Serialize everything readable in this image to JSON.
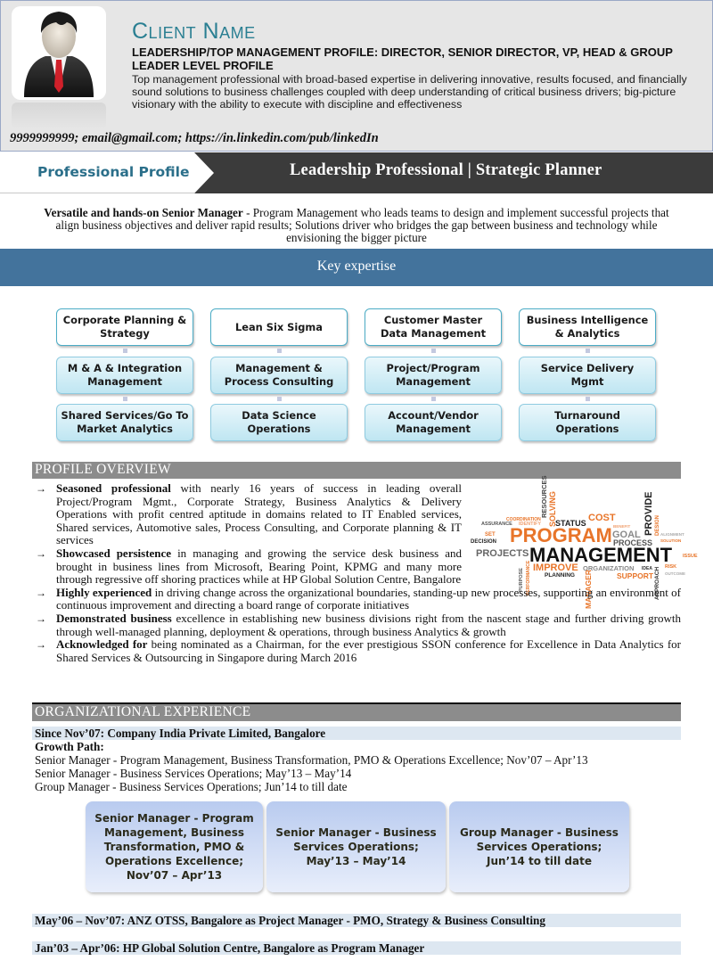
{
  "header": {
    "avatar_icon": "businessman-avatar-icon",
    "client_name": "Client Name",
    "title_line": "LEADERSHIP/TOP MANAGEMENT PROFILE: DIRECTOR, SENIOR DIRECTOR, VP, HEAD & GROUP LEADER LEVEL PROFILE",
    "summary": "Top management professional with broad-based expertise in delivering innovative, results focused, and financially sound solutions to business challenges coupled with deep understanding of critical business drivers; big-picture visionary with the ability to execute with discipline and effectiveness",
    "contact": "9999999999; email@gmail.com; https://in.linkedin.com/pub/linkedIn"
  },
  "banner": {
    "left_label": "Professional Profile",
    "right_title": "Leadership Professional | Strategic Planner"
  },
  "intro": {
    "bold": "Versatile and hands-on Senior Manager",
    "text": " - Program Management who leads teams to design and implement successful projects that align business objectives and deliver rapid results; Solutions driver who bridges the gap between business and technology while envisioning the bigger picture"
  },
  "key_expertise": {
    "title": "Key expertise",
    "columns": [
      [
        "Corporate Planning & Strategy",
        "M & A & Integration Management",
        "Shared Services/Go To Market Analytics"
      ],
      [
        "Lean Six Sigma",
        "Management & Process Consulting",
        "Data Science Operations"
      ],
      [
        "Customer Master Data Management",
        "Project/Program Management",
        "Account/Vendor Management"
      ],
      [
        "Business Intelligence & Analytics",
        "Service Delivery Mgmt",
        "Turnaround Operations"
      ]
    ]
  },
  "profile_overview": {
    "title": "PROFILE OVERVIEW",
    "bullet_icon": "right-arrow-icon",
    "bullets": [
      {
        "bold": "Seasoned professional",
        "text": " with nearly 16 years of success in leading overall Project/Program Mgmt., Corporate Strategy, Business Analytics & Delivery Operations with profit centred aptitude in domains related to IT Enabled services, Shared services, Automotive sales, Process Consulting, and Corporate planning & IT services"
      },
      {
        "bold": "Showcased persistence",
        "text": " in managing and growing the service desk business and brought in business lines from Microsoft, Bearing Point, KPMG and many more through regressive off shoring practices while at HP Global Solution Centre, Bangalore"
      },
      {
        "bold": "Highly experienced",
        "text": " in driving change across the organizational boundaries, standing-up new processes, supporting an environment of continuous improvement and directing a board range of corporate initiatives"
      },
      {
        "bold": "Demonstrated business",
        "text": " excellence in establishing new business divisions right from the nascent stage and further driving growth through well-managed planning, deployment & operations, through business Analytics & growth"
      },
      {
        "bold": "Acknowledged for",
        "text": " being nominated as a Chairman, for the ever prestigious SSON conference for Excellence in Data Analytics for Shared Services & Outsourcing in Singapore during March 2016"
      }
    ],
    "word_cloud": {
      "main": [
        "PROGRAM",
        "MANAGEMENT"
      ],
      "words": [
        "COORDINATION",
        "RESOURCES",
        "SOLVING",
        "ASSURANCE",
        "IDENTIFY",
        "STATUS",
        "COST",
        "BENEFIT",
        "PROVIDE",
        "DESIGN",
        "SET",
        "DECISION",
        "GOAL",
        "ALIGNMENT",
        "PROCESS",
        "SOLUTION",
        "PROJECTS",
        "ISSUE",
        "PURPOSE",
        "PERFORMANCE",
        "IMPROVE",
        "ORGANIZATION",
        "IDEA",
        "RISK",
        "OUTCOME",
        "PLANNING",
        "MANAGER",
        "SUPPORT",
        "APPROACH"
      ],
      "colors": {
        "orange": "#e8752a",
        "dark": "#1a1a1a",
        "gray": "#8a8a8a"
      }
    }
  },
  "organizational_experience": {
    "title": "ORGANIZATIONAL EXPERIENCE",
    "current_company": "Since Nov’07: Company India Private Limited, Bangalore",
    "growth_path_label": "Growth Path:",
    "growth_path": [
      "Senior Manager - Program Management, Business Transformation, PMO & Operations Excellence; Nov’07 – Apr’13",
      "Senior Manager - Business Services Operations; May’13 – May’14",
      "Group Manager - Business Services Operations; Jun’14 to till date"
    ],
    "path_boxes": [
      "Senior Manager - Program Management, Business Transformation, PMO & Operations Excellence; Nov’07 – Apr’13",
      "Senior Manager - Business Services Operations; May’13 – May’14",
      "Group Manager - Business Services Operations; Jun’14 to till date"
    ],
    "previous_roles": [
      "May’06 – Nov’07: ANZ OTSS, Bangalore as Project Manager - PMO, Strategy & Business Consulting",
      "Jan’03 – Apr’06: HP Global Solution Centre, Bangalore as Program Manager"
    ]
  }
}
